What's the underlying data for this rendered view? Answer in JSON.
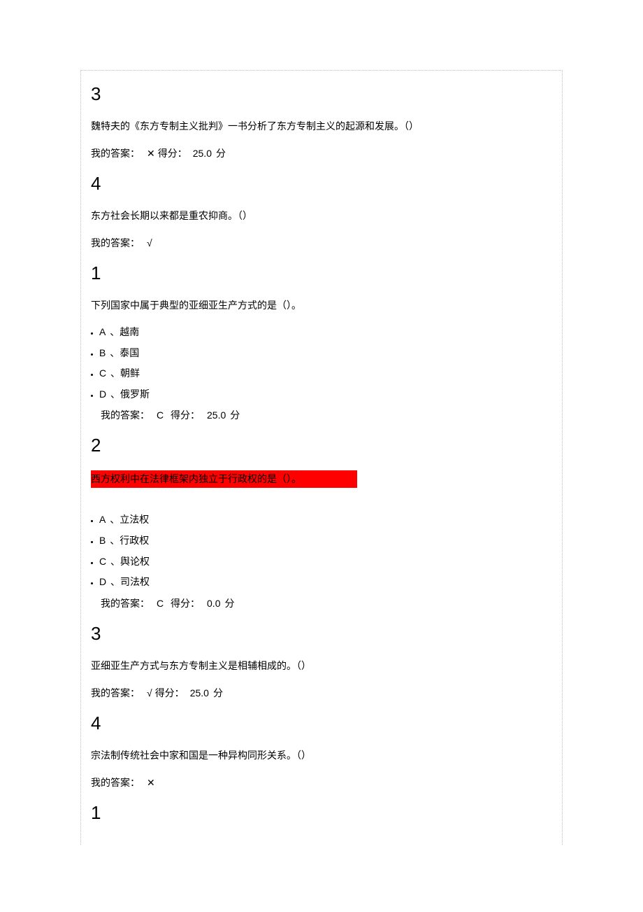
{
  "common": {
    "answer_label": "我的答案：",
    "score_label": "得分：",
    "score_unit": "分"
  },
  "questions": [
    {
      "num": "3",
      "stem": "魏特夫的《东方专制主义批判》一书分析了东方专制主义的起源和发展。（）",
      "answer_mark": "✕",
      "score": "25.0",
      "highlight": false,
      "options": null,
      "inline_score": true
    },
    {
      "num": "4",
      "stem": "东方社会长期以来都是重农抑商。（）",
      "answer_mark": "√",
      "score": null,
      "highlight": false,
      "options": null,
      "inline_score": false
    },
    {
      "num": "1",
      "stem": "下列国家中属于典型的亚细亚生产方式的是（）。",
      "answer_mark": "C",
      "score": "25.0",
      "highlight": false,
      "options": [
        {
          "letter": "A",
          "text": "越南"
        },
        {
          "letter": "B",
          "text": "泰国"
        },
        {
          "letter": "C",
          "text": "朝鲜"
        },
        {
          "letter": "D",
          "text": "俄罗斯"
        }
      ],
      "inline_score": true
    },
    {
      "num": "2",
      "stem": "西方权利中在法律框架内独立于行政权的是（）。",
      "answer_mark": "C",
      "score": "0.0",
      "highlight": true,
      "options": [
        {
          "letter": "A",
          "text": "立法权"
        },
        {
          "letter": "B",
          "text": "行政权"
        },
        {
          "letter": "C",
          "text": "舆论权"
        },
        {
          "letter": "D",
          "text": "司法权"
        }
      ],
      "inline_score": true
    },
    {
      "num": "3",
      "stem": "亚细亚生产方式与东方专制主义是相辅相成的。（）",
      "answer_mark": "√",
      "score": "25.0",
      "highlight": false,
      "options": null,
      "inline_score": true
    },
    {
      "num": "4",
      "stem": "宗法制传统社会中家和国是一种异构同形关系。（）",
      "answer_mark": "✕",
      "score": null,
      "highlight": false,
      "options": null,
      "inline_score": false
    },
    {
      "num": "1",
      "stem": null,
      "answer_mark": null,
      "score": null,
      "highlight": false,
      "options": null,
      "inline_score": false
    }
  ]
}
